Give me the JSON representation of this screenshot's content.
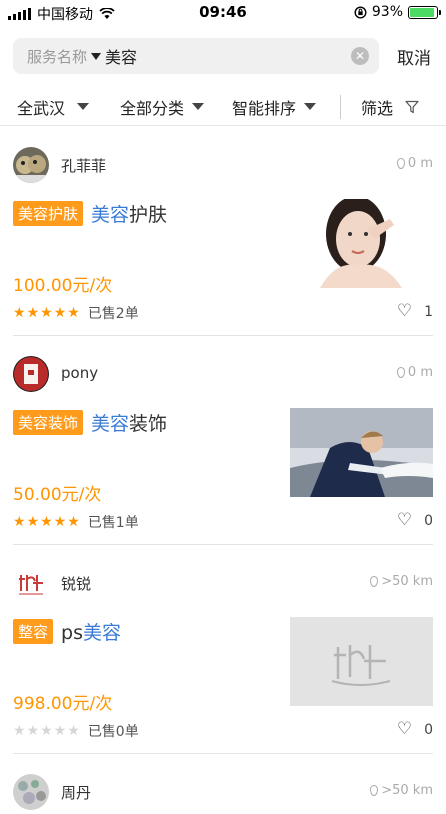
{
  "status_bar": {
    "carrier": "中国移动",
    "time": "09:46",
    "battery": "93%",
    "battery_level": 0.93
  },
  "search": {
    "type_label": "服务名称",
    "value": "美容",
    "cancel_label": "取消"
  },
  "filters": [
    {
      "label": "全武汉"
    },
    {
      "label": "全部分类"
    },
    {
      "label": "智能排序"
    },
    {
      "label": "筛选"
    }
  ],
  "listings": [
    {
      "shop": "孔菲菲",
      "distance": "0 m",
      "tag": "美容护肤",
      "title_hl": "美容",
      "title_rest": "护肤",
      "price": "100.00元/次",
      "rating": 5,
      "sold": "已售2单",
      "likes": "1"
    },
    {
      "shop": "pony",
      "distance": "0 m",
      "tag": "美容装饰",
      "title_hl": "美容",
      "title_rest": "装饰",
      "price": "50.00元/次",
      "rating": 5,
      "sold": "已售1单",
      "likes": "0"
    },
    {
      "shop": "锐锐",
      "distance": ">50 km",
      "tag": "整容",
      "title_pre": "ps",
      "title_hl": "美容",
      "price": "998.00元/次",
      "rating": 0,
      "sold": "已售0单",
      "likes": "0"
    },
    {
      "shop": "周丹",
      "distance": ">50 km"
    }
  ],
  "colors": {
    "accent_orange": "#ff9500",
    "tag_bg": "#ff9b1a",
    "highlight_blue": "#3a7bd5"
  },
  "icons": [
    "wifi-icon",
    "lock-rotation-icon",
    "battery-icon",
    "caret-down-icon",
    "clear-icon",
    "filter-funnel-icon",
    "location-pin-icon",
    "star-icon",
    "heart-icon"
  ]
}
